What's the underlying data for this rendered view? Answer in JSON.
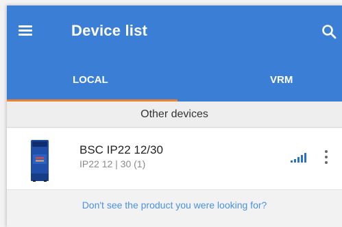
{
  "app": {
    "title": "Device list",
    "menu_icon": "hamburger-menu-icon",
    "search_icon": "search-icon",
    "header_color": "#3a7fd5",
    "accent_color": "#f07f2e"
  },
  "tabs": [
    {
      "label": "LOCAL",
      "selected": true
    },
    {
      "label": "VRM",
      "selected": false
    }
  ],
  "section": {
    "title": "Other devices"
  },
  "devices": [
    {
      "name": "BSC IP22 12/30",
      "subtitle": "IP22 12 | 30 (1)",
      "signal_icon": "signal-strength-icon",
      "more_icon": "more-vertical-icon"
    }
  ],
  "footer": {
    "help_link": "Don't see the product you were looking for?"
  }
}
